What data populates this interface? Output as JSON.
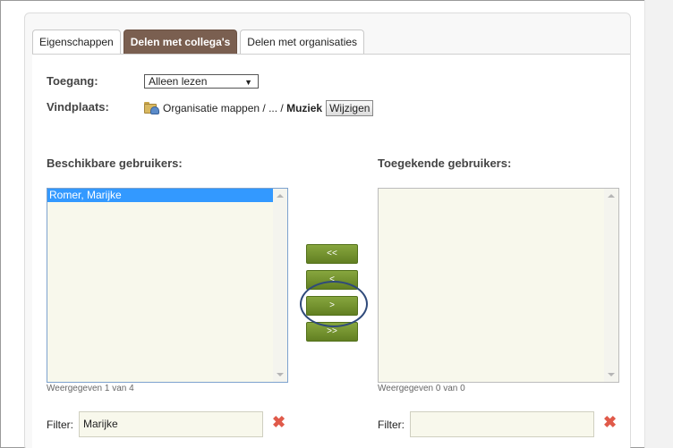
{
  "tabs": [
    {
      "label": "Eigenschappen",
      "active": false
    },
    {
      "label": "Delen met collega's",
      "active": true
    },
    {
      "label": "Delen met organisaties",
      "active": false
    }
  ],
  "form": {
    "toegang_label": "Toegang:",
    "toegang_value": "Alleen lezen",
    "vindplaats_label": "Vindplaats:",
    "vindplaats_path": "Organisatie mappen / ... / ",
    "vindplaats_folder": "Muziek",
    "wijzigen_label": "Wijzigen"
  },
  "available": {
    "heading": "Beschikbare gebruikers:",
    "items": [
      "Romer, Marijke"
    ],
    "count_text": "Weergegeven 1 van 4",
    "filter_label": "Filter:",
    "filter_value": "Marijke"
  },
  "assigned": {
    "heading": "Toegekende gebruikers:",
    "items": [],
    "count_text": "Weergegeven 0 van 0",
    "filter_label": "Filter:",
    "filter_value": ""
  },
  "move_buttons": {
    "remove_all": "<<",
    "remove_one": "<",
    "add_one": ">",
    "add_all": ">>"
  },
  "colors": {
    "active_tab": "#7a5f50",
    "move_button": "#6f8d2c",
    "selected_item": "#3399ff",
    "clear_icon": "#e05a4a",
    "highlight_circle": "#2f4a7a"
  },
  "icons": {
    "folder": "folder-shared-icon",
    "clear": "close-x-icon"
  }
}
